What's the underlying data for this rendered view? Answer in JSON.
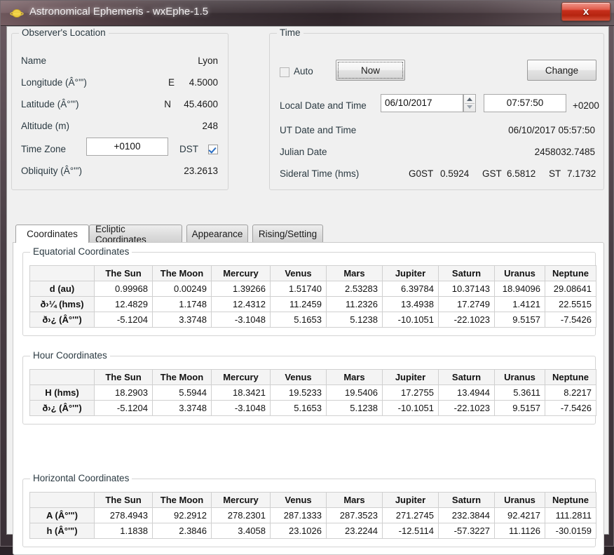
{
  "window": {
    "title": "Astronomical Ephemeris - wxEphe-1.5",
    "app_icon": "saturn-planet-icon",
    "close_label": "x",
    "accent_close": "#c62f1c"
  },
  "observer": {
    "group_title": "Observer's Location",
    "rows": [
      {
        "label": "Name",
        "value": "Lyon"
      },
      {
        "label": "Longitude (Â°'\")",
        "prefix": "E",
        "value": "4.5000"
      },
      {
        "label": "Latitude (Â°'\")",
        "prefix": "N",
        "value": "45.4600"
      },
      {
        "label": "Altitude (m)",
        "value": "248"
      },
      {
        "label": "Obliquity (Â°'\")",
        "value": "23.2613"
      }
    ],
    "timezone_label": "Time Zone",
    "timezone_value": "+0100",
    "dst_label": "DST",
    "dst_checked": true
  },
  "time": {
    "group_title": "Time",
    "auto_label": "Auto",
    "auto_checked": false,
    "now_label": "Now",
    "change_label": "Change",
    "local_label": "Local Date and Time",
    "local_date": "06/10/2017",
    "local_time": "07:57:50",
    "local_offset": "+0200",
    "ut_label": "UT Date and Time",
    "ut_value": "06/10/2017 05:57:50",
    "julian_label": "Julian Date",
    "julian_value": "2458032.7485",
    "sidereal_label": "Sideral Time (hms)",
    "sidereal": [
      {
        "name": "G0ST",
        "value": "0.5924"
      },
      {
        "name": "GST",
        "value": "6.5812"
      },
      {
        "name": "ST",
        "value": "7.1732"
      }
    ]
  },
  "tabs": [
    {
      "label": "Coordinates",
      "active": true
    },
    {
      "label": "Ecliptic Coordinates",
      "active": false
    },
    {
      "label": "Appearance",
      "active": false
    },
    {
      "label": "Rising/Setting",
      "active": false
    }
  ],
  "bodies": [
    "The Sun",
    "The Moon",
    "Mercury",
    "Venus",
    "Mars",
    "Jupiter",
    "Saturn",
    "Uranus",
    "Neptune"
  ],
  "tables": {
    "equatorial": {
      "group_title": "Equatorial Coordinates",
      "columns": [
        "",
        "The Sun",
        "The Moon",
        "Mercury",
        "Venus",
        "Mars",
        "Jupiter",
        "Saturn",
        "Uranus",
        "Neptune"
      ],
      "rows": [
        {
          "label": "d (au)",
          "values": [
            "0.99968",
            "0.00249",
            "1.39266",
            "1.51740",
            "2.53283",
            "6.39784",
            "10.37143",
            "18.94096",
            "29.08641"
          ]
        },
        {
          "label": "ð›¼ (hms)",
          "values": [
            "12.4829",
            "1.1748",
            "12.4312",
            "11.2459",
            "11.2326",
            "13.4938",
            "17.2749",
            "1.4121",
            "22.5515"
          ]
        },
        {
          "label": "ð›¿ (Â°'\")",
          "values": [
            "-5.1204",
            "3.3748",
            "-3.1048",
            "5.1653",
            "5.1238",
            "-10.1051",
            "-22.1023",
            "9.5157",
            "-7.5426"
          ]
        }
      ]
    },
    "hour": {
      "group_title": "Hour Coordinates",
      "columns": [
        "",
        "The Sun",
        "The Moon",
        "Mercury",
        "Venus",
        "Mars",
        "Jupiter",
        "Saturn",
        "Uranus",
        "Neptune"
      ],
      "rows": [
        {
          "label": "H (hms)",
          "values": [
            "18.2903",
            "5.5944",
            "18.3421",
            "19.5233",
            "19.5406",
            "17.2755",
            "13.4944",
            "5.3611",
            "8.2217"
          ]
        },
        {
          "label": "ð›¿ (Â°'\")",
          "values": [
            "-5.1204",
            "3.3748",
            "-3.1048",
            "5.1653",
            "5.1238",
            "-10.1051",
            "-22.1023",
            "9.5157",
            "-7.5426"
          ]
        }
      ]
    },
    "horizontal": {
      "group_title": "Horizontal Coordinates",
      "columns": [
        "",
        "The Sun",
        "The Moon",
        "Mercury",
        "Venus",
        "Mars",
        "Jupiter",
        "Saturn",
        "Uranus",
        "Neptune"
      ],
      "rows": [
        {
          "label": "A (Â°'\")",
          "values": [
            "278.4943",
            "92.2912",
            "278.2301",
            "287.1333",
            "287.3523",
            "271.2745",
            "232.3844",
            "92.4217",
            "111.2811"
          ]
        },
        {
          "label": "h (Â°'\")",
          "values": [
            "1.1838",
            "2.3846",
            "3.4058",
            "23.1026",
            "23.2244",
            "-12.5114",
            "-57.3227",
            "11.1126",
            "-30.0159"
          ]
        }
      ]
    }
  }
}
